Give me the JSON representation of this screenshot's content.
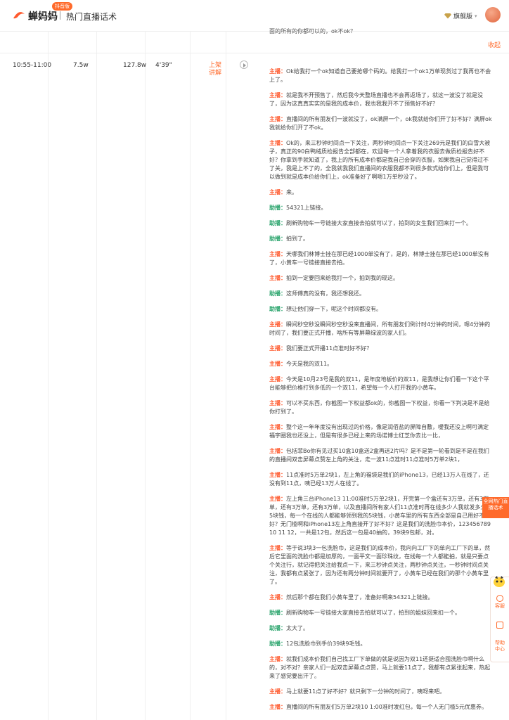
{
  "header": {
    "logo_text": "蝉妈妈",
    "logo_badge": "抖音版",
    "page_title": "热门直播话术",
    "vip_label": "旗舰版"
  },
  "top_fragment": "面的所有的你都可以的，ok不ok？",
  "collapse_label": "收起",
  "row": {
    "time": "10:55-11:00",
    "value1": "7.5w",
    "value2": "127.8w",
    "duration": "4'39\"",
    "tag": "上架讲解"
  },
  "lines": [
    {
      "speaker": "主播：",
      "role": "host",
      "text": "Ok给我打一个ok知道自己要抢哪个码的。给我打一个ok1万单现货过了我再也不会上了。"
    },
    {
      "speaker": "主播：",
      "role": "host",
      "text": "就是我不开预售了，然后我今天整场直播也不会再返场了，就这一波没了就是没了，因为这真真实实的是我的成本价，我也我我开不了预售好不好？"
    },
    {
      "speaker": "主播：",
      "role": "host",
      "text": "直播间的所有朋友们一波就没了，ok满屏一个，ok我就给你们开了好不好？满屏ok我就给你们开了不ok。"
    },
    {
      "speaker": "主播：",
      "role": "host",
      "text": "Ok的，来三秒钟时间点一下关注，两秒钟时间点一下关注269元是我们的白雪大被子，真正的90白鸭绒质检报告全部都在，欢迎每一个人拿着我的衣服去做质检报告好不好？你拿到手就知道了，我上的所有成本价都是我自己会穿的衣服，如果我自己觉得过不了关，我是上不了的，全我就我我们直播间的衣服我都不到很多款式给你们上，但是我可以做到就是成本价给你们上，ok准备好了啊嗯1万单秒没了。"
    },
    {
      "speaker": "主播：",
      "role": "host",
      "text": "来。"
    },
    {
      "speaker": "助播：",
      "role": "asst",
      "text": "54321上链接。"
    },
    {
      "speaker": "助播：",
      "role": "asst",
      "text": "刷新购物车一号链接大家直接去拍就可以了，拍到的女生我们回来打一个。"
    },
    {
      "speaker": "助播：",
      "role": "asst",
      "text": "拍到了。"
    },
    {
      "speaker": "主播：",
      "role": "host",
      "text": "天哪我们林博士挂在那已经1000单没有了，是的，林博士挂在那已经1000单没有了，小黄车一号链接直接去拍。"
    },
    {
      "speaker": "主播：",
      "role": "host",
      "text": "拍到一定要回来给我打一个，拍到我的现这。"
    },
    {
      "speaker": "助播：",
      "role": "asst",
      "text": "这师傅真的没有，我还想我还。"
    },
    {
      "speaker": "助播：",
      "role": "asst",
      "text": "想让他们穿一下，呢这个时间都没有。"
    },
    {
      "speaker": "主播：",
      "role": "host",
      "text": "瞬间秒空秒没瞬间秒空秒没来直播间，所有朋友们倒计时4分钟的时间，嗯4分钟的时间了，我们要正式开播，啥所有等屏幕绿波的家人们。"
    },
    {
      "speaker": "主播：",
      "role": "host",
      "text": "我们要正式开播11点准时好不好？"
    },
    {
      "speaker": "主播：",
      "role": "host",
      "text": "今天是我的双11。"
    },
    {
      "speaker": "主播：",
      "role": "host",
      "text": "今天是10月23号是我的双11，是年度地板价的双11，是我想让你们看一下这个平台能够把价格打到多低的一个双11，希望每一个人打开我的小黄车。"
    },
    {
      "speaker": "主播：",
      "role": "host",
      "text": "可以不买东西，你截图一下权益都ok的，你截图一下权益，你看一下判决是不是给你打到了。"
    },
    {
      "speaker": "主播：",
      "role": "host",
      "text": "整个这一年年度没有出现过的价格，像是润佰盐的屏障自敷，嗳我还没上啊可满定福字圈我也还没上，但是有很多已经上来的场诺博士红芝你去比一比，"
    },
    {
      "speaker": "主播：",
      "role": "host",
      "text": "包括菲Bo你有见过买10盒10盒送2盒再送2片吗？是不是第一轮看到是不是在我们的直播间双击屏幕点赞左上角的关注，走一波11点准时11点准时5万单2块1，"
    },
    {
      "speaker": "主播：",
      "role": "host",
      "text": "11点准时5万单2块1，左上角的福袋是我们的iPhone13，已经13万人在线了，还没有到11点，咦已经13万人在线了。"
    },
    {
      "speaker": "主播：",
      "role": "host",
      "text": "左上角三台iPhone13 11:00准时5万单2块1，开完第一个盒还有3万单，还有3万单，还有3万单，还有3万单，以及直播间所有家人们11点准时再在线多少人我就发多少个5块钱，每一个在线的人都能够领到我的5块钱，小黄车里的所有东西全部是自己用好不好？无门槛啊和iPhone13左上角直接开了好不好？这是我们的洗脸巾本价，123456789 10 11 12，一共是12包，然后这一包是40抽的，39块9包邮，对。"
    },
    {
      "speaker": "主播：",
      "role": "host",
      "text": "等于说3块3一包洗脸巾，这是我们的成本价，我向向工厂下的单向工厂下的单，然后它里面的洗脸巾都是加厚的，一面平文一面珍珠纹，在线每一个人都能拍，就是只要点个关注行，就记得把关注给我点一下，来三秒钟点关注，两秒钟点关注，一秒钟时间点关注，我都有点紧张了，因为还有两分钟时间就要开了，小黄车已经在我们的那个小黄车里了。"
    },
    {
      "speaker": "主播：",
      "role": "host",
      "text": "然后那个都在我们小黄车里了，准备好啊来54321上链接。"
    },
    {
      "speaker": "助播：",
      "role": "asst",
      "text": "刷新购物车一号链接大家直接去拍就可以了，拍到的姐妹回来扣一个。"
    },
    {
      "speaker": "助播：",
      "role": "asst",
      "text": "太大了。"
    },
    {
      "speaker": "助播：",
      "role": "asst",
      "text": "12包洗脸巾到手价39块9毛钱。"
    },
    {
      "speaker": "主播：",
      "role": "host",
      "text": "就我们成本价我们自己找工厂下单做的就是说因为双11还挺适合囤洗脸巾啊什么的，对不对？亲家人们一起双击屏幕点点赞，马上就要11点了，我都有点紧张起来，热起来了感觉要出汗了。"
    },
    {
      "speaker": "主播：",
      "role": "host",
      "text": "马上就要11点了好不好？就只剩下一分钟的时间了，咦呀来吧。"
    },
    {
      "speaker": "主播：",
      "role": "host",
      "text": "直播间的所有朋友们5万单2块10 1:00准时发红包，每一个人无门槛5元优惠券。"
    }
  ],
  "hot_tab": "全网热门直播话术",
  "side": {
    "service": "客服",
    "help": "帮助中心"
  },
  "colors": {
    "accent": "#ff6a2b",
    "host": "#ff5a2e",
    "assistant": "#27a36a"
  }
}
